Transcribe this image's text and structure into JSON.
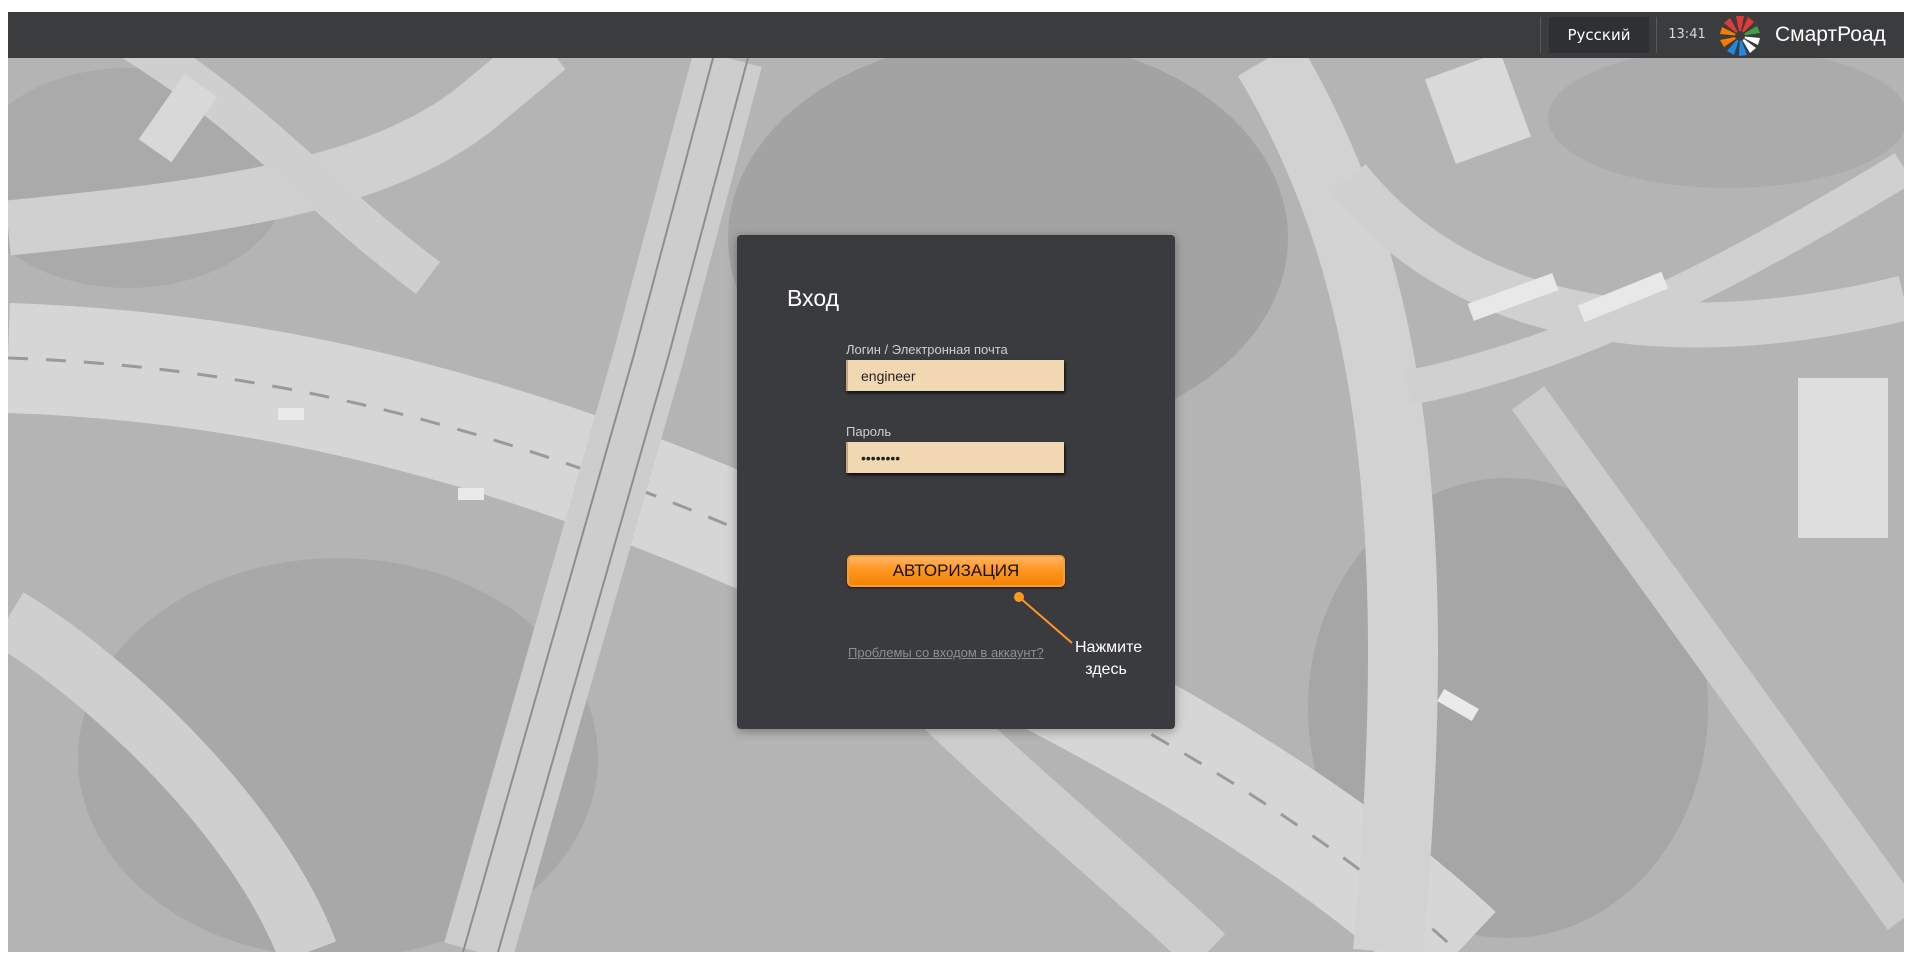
{
  "header": {
    "language": "Русский",
    "time": "13:41",
    "brand": "СмартРоад"
  },
  "login": {
    "title": "Вход",
    "login_label": "Логин / Электронная почта",
    "login_value": "engineer",
    "password_label": "Пароль",
    "password_value": "••••••••",
    "submit_label": "АВТОРИЗАЦИЯ",
    "forgot_link": "Проблемы со входом в аккаунт?"
  },
  "annotation": {
    "line1": "Нажмите",
    "line2": "здесь"
  },
  "colors": {
    "topbar": "#3b3c3e",
    "card": "#3a3b3f",
    "input_bg": "#f2d7b3",
    "accent_orange": "#ff9722",
    "logo_red": "#e53935",
    "logo_orange": "#f57c00",
    "logo_teal": "#1e88e5",
    "logo_green": "#43a047"
  },
  "icons": {
    "logo": "smartroad-logo-icon"
  }
}
